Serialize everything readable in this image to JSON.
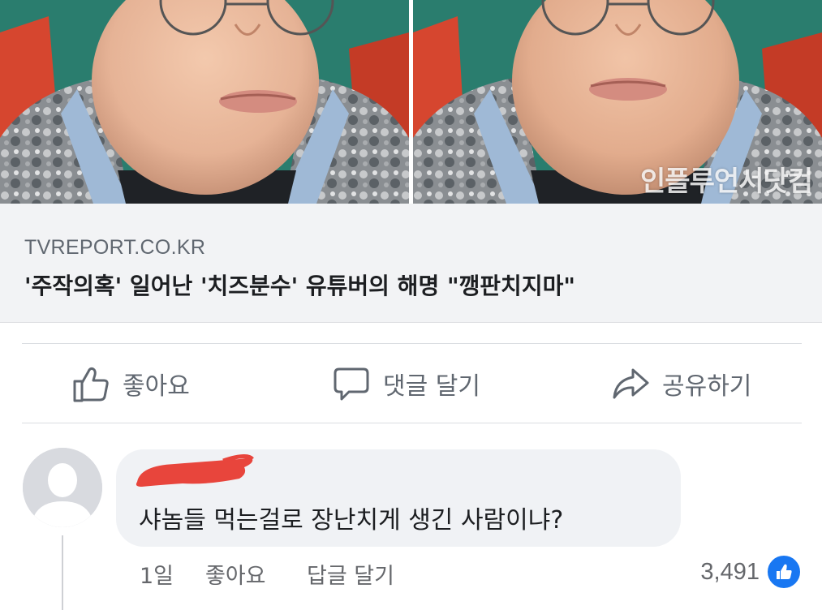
{
  "preview": {
    "watermark": "인플루언서닷컴",
    "image_left_icon": "face-photo-icon",
    "image_right_icon": "face-photo-icon"
  },
  "link": {
    "domain": "TVREPORT.CO.KR",
    "title": "'주작의혹' 일어난 '치즈분수' 유튜버의 해명 \"깽판치지마\""
  },
  "actions": {
    "like_label": "좋아요",
    "comment_label": "댓글 달기",
    "share_label": "공유하기",
    "like_icon": "thumbs-up-icon",
    "comment_icon": "speech-bubble-icon",
    "share_icon": "share-arrow-icon"
  },
  "comment": {
    "author": "",
    "text": "샤놈들 먹는걸로 장난치게 생긴 사람이냐?",
    "time": "1일",
    "like_label": "좋아요",
    "reply_label": "답글 달기",
    "reaction_count": "3,491",
    "reaction_icon": "like-reaction-icon"
  },
  "colors": {
    "facebook_blue": "#1877f2",
    "link_box_bg": "#f2f3f5",
    "bubble_bg": "#f0f2f5",
    "secondary_text": "#65676b",
    "redaction_red": "#e8453c"
  }
}
